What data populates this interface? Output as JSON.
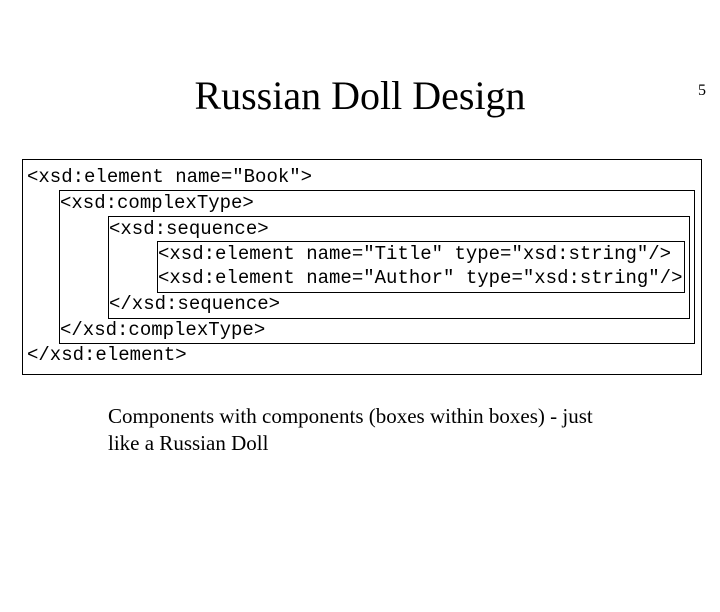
{
  "page_number": "5",
  "title": "Russian Doll Design",
  "code": {
    "l1": "<xsd:element name=\"Book\">",
    "l2": "<xsd:complexType>",
    "l3": "<xsd:sequence>",
    "l4": "<xsd:element name=\"Title\" type=\"xsd:string\"/>",
    "l5": "<xsd:element name=\"Author\" type=\"xsd:string\"/>",
    "l6": "</xsd:sequence>",
    "l7": "</xsd:complexType>",
    "l8": "</xsd:element>"
  },
  "caption": "Components with components (boxes within boxes) - just like a Russian Doll"
}
